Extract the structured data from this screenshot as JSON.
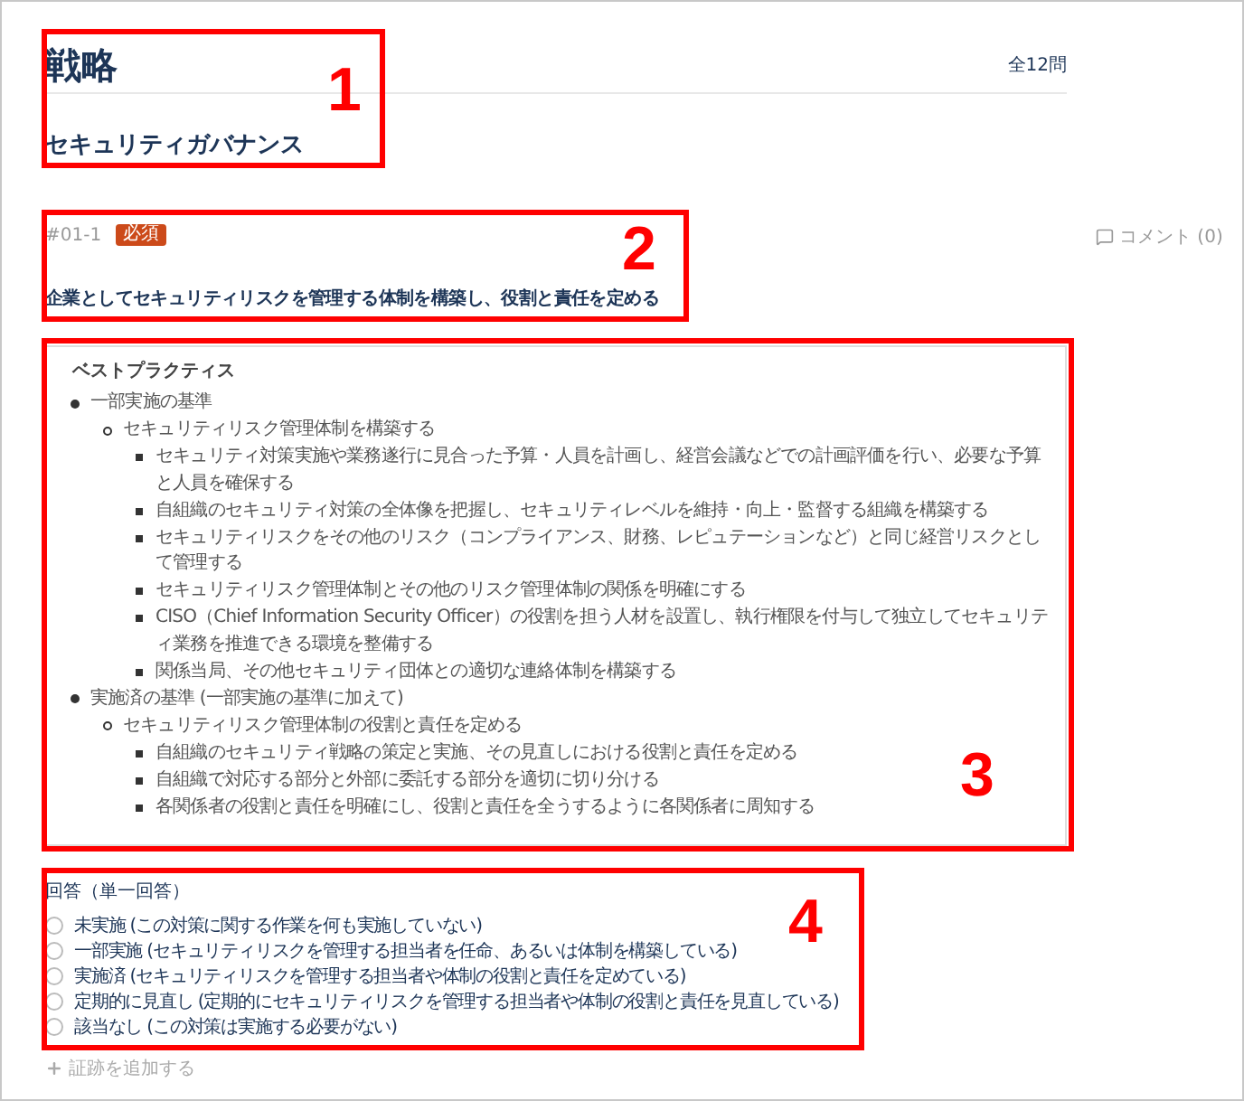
{
  "header": {
    "title": "戦略",
    "count": "全12問",
    "subtitle": "セキュリティガバナンス"
  },
  "question": {
    "id": "#01-1",
    "badge": "必須",
    "title": "企業としてセキュリティリスクを管理する体制を構築し、役割と責任を定める",
    "comment": "コメント (0)"
  },
  "best_practices": {
    "heading": "ベストプラクティス",
    "items": [
      {
        "text": "一部実施の基準",
        "children": [
          {
            "text": "セキュリティリスク管理体制を構築する",
            "children": [
              {
                "text": "セキュリティ対策実施や業務遂行に見合った予算・人員を計画し、経営会議などでの計画評価を行い、必要な予算と人員を確保する"
              },
              {
                "text": "自組織のセキュリティ対策の全体像を把握し、セキュリティレベルを維持・向上・監督する組織を構築する"
              },
              {
                "text": "セキュリティリスクをその他のリスク（コンプライアンス、財務、レピュテーションなど）と同じ経営リスクとして管理する"
              },
              {
                "text": "セキュリティリスク管理体制とその他のリスク管理体制の関係を明確にする"
              },
              {
                "text": "CISO（Chief Information Security Officer）の役割を担う人材を設置し、執行権限を付与して独立してセキュリティ業務を推進できる環境を整備する"
              },
              {
                "text": "関係当局、その他セキュリティ団体との適切な連絡体制を構築する"
              }
            ]
          }
        ]
      },
      {
        "text": "実施済の基準 (一部実施の基準に加えて)",
        "children": [
          {
            "text": "セキュリティリスク管理体制の役割と責任を定める",
            "children": [
              {
                "text": "自組織のセキュリティ戦略の策定と実施、その見直しにおける役割と責任を定める"
              },
              {
                "text": "自組織で対応する部分と外部に委託する部分を適切に切り分ける"
              },
              {
                "text": "各関係者の役割と責任を明確にし、役割と責任を全うするように各関係者に周知する"
              }
            ]
          }
        ]
      }
    ]
  },
  "answer": {
    "label": "回答（単一回答）",
    "options": [
      {
        "label": "未実施 (この対策に関する作業を何も実施していない)",
        "selected": false
      },
      {
        "label": "一部実施 (セキュリティリスクを管理する担当者を任命、あるいは体制を構築している)",
        "selected": false
      },
      {
        "label": "実施済 (セキュリティリスクを管理する担当者や体制の役割と責任を定めている)",
        "selected": false
      },
      {
        "label": "定期的に見直し (定期的にセキュリティリスクを管理する担当者や体制の役割と責任を見直している)",
        "selected": false
      },
      {
        "label": "該当なし (この対策は実施する必要がない)",
        "selected": false
      }
    ]
  },
  "add_evidence": "証跡を追加する",
  "callouts": [
    {
      "number": "1"
    },
    {
      "number": "2"
    },
    {
      "number": "3"
    },
    {
      "number": "4"
    }
  ]
}
